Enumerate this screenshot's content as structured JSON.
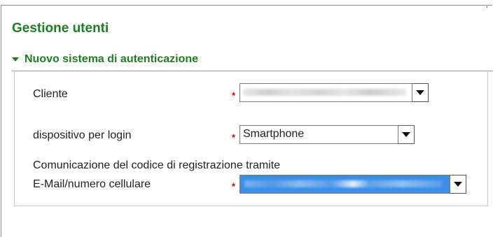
{
  "page": {
    "title": "Gestione utenti"
  },
  "section": {
    "header": "Nuovo sistema di autenticazione"
  },
  "form": {
    "cliente": {
      "label": "Cliente",
      "required_mark": "*",
      "value": ""
    },
    "dispositivo": {
      "label": "dispositivo per login",
      "required_mark": "*",
      "value": "Smartphone"
    },
    "comunicazione_note": "Comunicazione del codice di registrazione tramite",
    "contatto": {
      "label": "E-Mail/numero cellulare",
      "required_mark": "*",
      "value": ""
    }
  },
  "icons": {
    "section_toggle": "triangle-down-icon",
    "select_arrow": "chevron-down-icon"
  },
  "colors": {
    "heading_green": "#1e7d1e",
    "required_red": "#d40000",
    "selection_blue": "#3a8ee6"
  }
}
